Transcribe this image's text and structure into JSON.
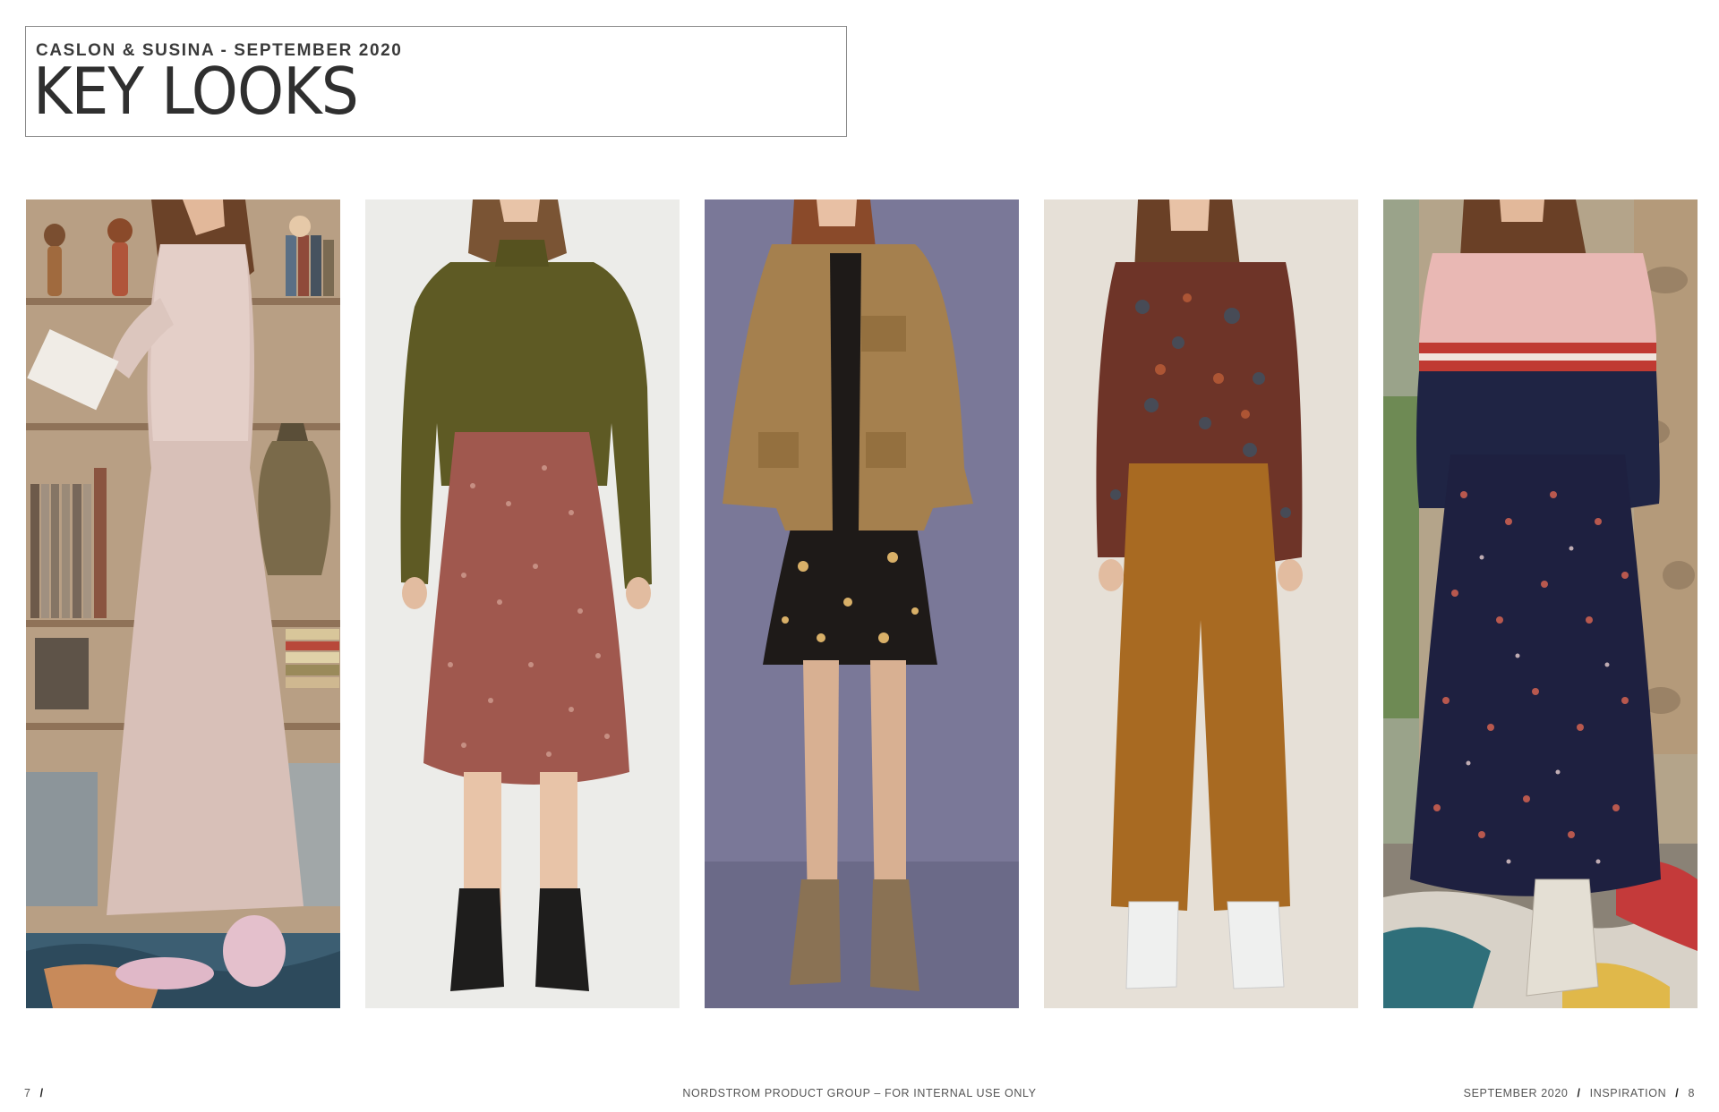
{
  "header": {
    "subtitle": "CASLON & SUSINA - SEPTEMBER 2020",
    "title": "KEY LOOKS"
  },
  "looks": [
    {
      "id": "look-1"
    },
    {
      "id": "look-2"
    },
    {
      "id": "look-3"
    },
    {
      "id": "look-4"
    },
    {
      "id": "look-5"
    }
  ],
  "footer": {
    "page_left": "7",
    "center": "NORDSTROM PRODUCT GROUP – FOR INTERNAL USE ONLY",
    "right_date": "SEPTEMBER 2020",
    "right_section": "INSPIRATION",
    "page_right": "8",
    "separator": "/"
  }
}
